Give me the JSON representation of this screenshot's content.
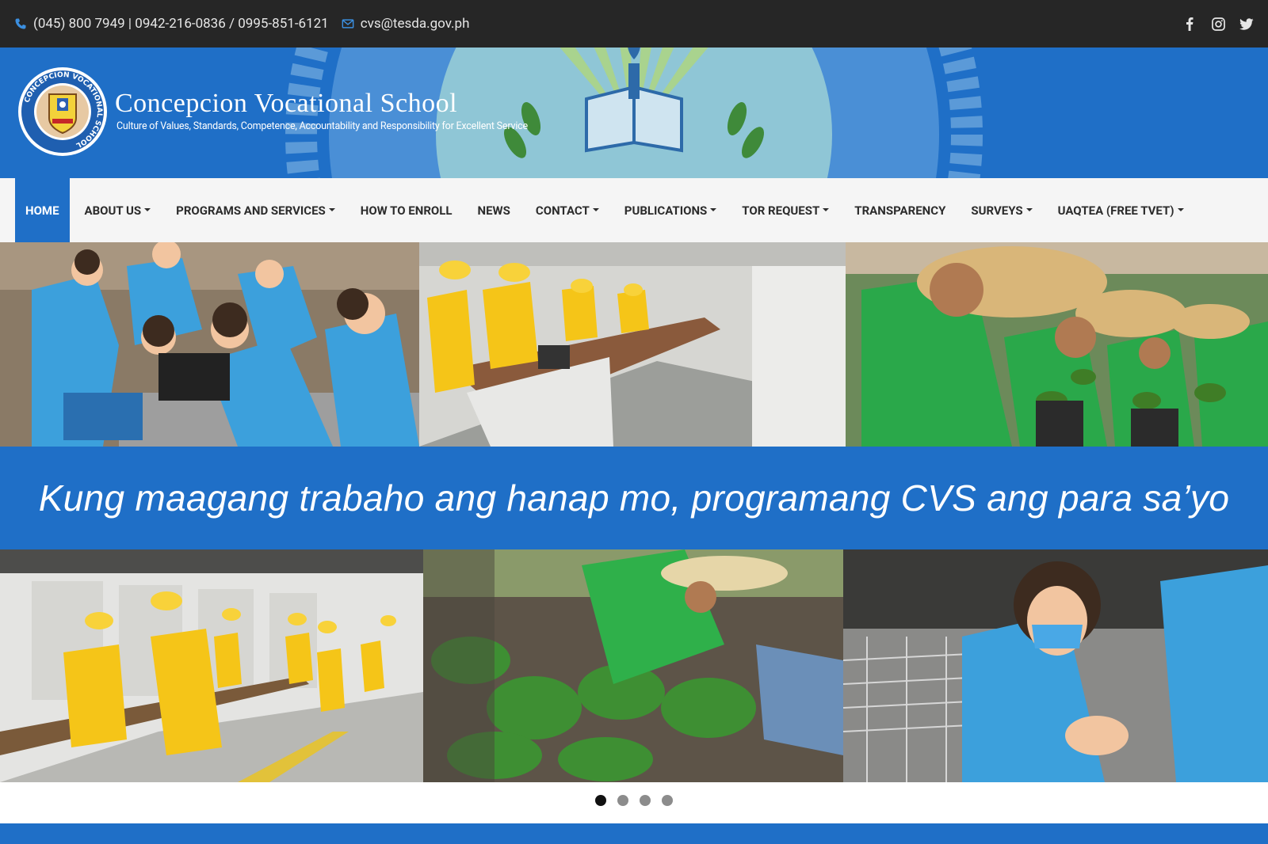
{
  "topbar": {
    "phones": "(045) 800 7949 | 0942-216-0836 / 0995-851-6121",
    "email": "cvs@tesda.gov.ph",
    "social_icons": [
      "facebook-icon",
      "instagram-icon",
      "twitter-icon"
    ]
  },
  "brand": {
    "title": "Concepcion Vocational School",
    "tagline": "Culture of Values, Standards, Competence, Accountability and Responsibility for Excellent Service",
    "logo_text": "CONCEPCION VOCATIONAL SCHOOL",
    "colors": {
      "primary": "#1f6fc7",
      "topbar": "#262626",
      "nav_bg": "#f5f5f5"
    }
  },
  "nav": {
    "items": [
      {
        "label": "HOME",
        "dropdown": false,
        "active": true
      },
      {
        "label": "ABOUT US",
        "dropdown": true,
        "active": false
      },
      {
        "label": "PROGRAMS AND SERVICES",
        "dropdown": true,
        "active": false
      },
      {
        "label": "HOW TO ENROLL",
        "dropdown": false,
        "active": false
      },
      {
        "label": "NEWS",
        "dropdown": false,
        "active": false
      },
      {
        "label": "CONTACT",
        "dropdown": true,
        "active": false
      },
      {
        "label": "PUBLICATIONS",
        "dropdown": true,
        "active": false
      },
      {
        "label": "TOR REQUEST",
        "dropdown": true,
        "active": false
      },
      {
        "label": "TRANSPARENCY",
        "dropdown": false,
        "active": false
      },
      {
        "label": "SURVEYS",
        "dropdown": true,
        "active": false
      },
      {
        "label": "UAQTEA (FREE TVET)",
        "dropdown": true,
        "active": false
      }
    ]
  },
  "carousel": {
    "slogan": "Kung maagang trabaho ang hanap mo, programang CVS ang para sa’yo",
    "slide_count": 4,
    "active_slide": 1
  }
}
